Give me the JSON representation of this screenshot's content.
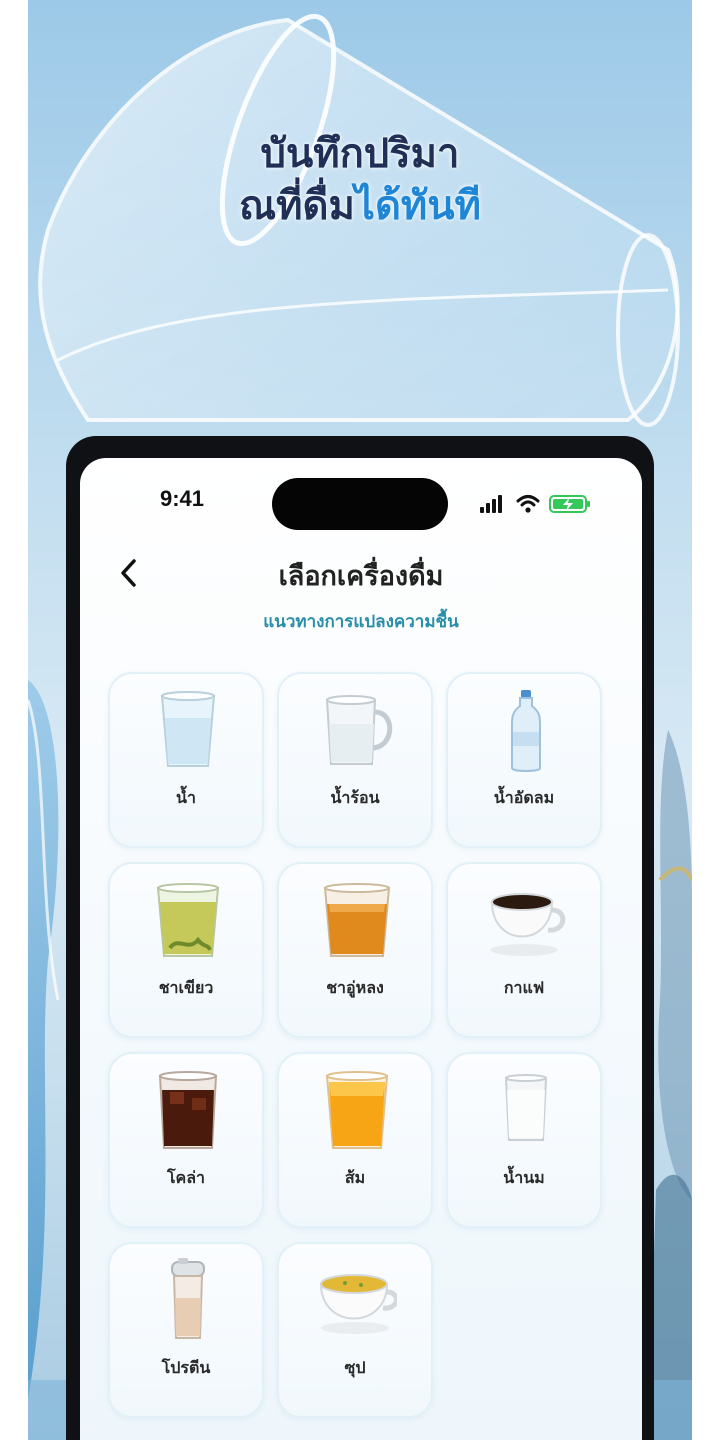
{
  "headline": {
    "line1": "บันทึกปริมา",
    "line2_plain": "ณที่ดื่ม",
    "line2_accent": "ได้ทันที"
  },
  "status_bar": {
    "time": "9:41"
  },
  "header": {
    "title": "เลือกเครื่องดื่ม",
    "subtitle": "แนวทางการแปลงความชื้น"
  },
  "drinks": [
    {
      "label": "น้ำ",
      "icon": "water-glass-icon"
    },
    {
      "label": "น้ำร้อน",
      "icon": "hot-water-mug-icon"
    },
    {
      "label": "น้ำอัดลม",
      "icon": "soda-bottle-icon"
    },
    {
      "label": "ชาเขียว",
      "icon": "green-tea-icon"
    },
    {
      "label": "ชาอู่หลง",
      "icon": "oolong-tea-icon"
    },
    {
      "label": "กาแฟ",
      "icon": "coffee-cup-icon"
    },
    {
      "label": "โคล่า",
      "icon": "cola-glass-icon"
    },
    {
      "label": "ส้ม",
      "icon": "orange-juice-icon"
    },
    {
      "label": "น้ำนม",
      "icon": "milk-glass-icon"
    },
    {
      "label": "โปรตีน",
      "icon": "protein-shaker-icon"
    },
    {
      "label": "ซุป",
      "icon": "soup-bowl-icon"
    }
  ],
  "colors": {
    "accent": "#1f86d6",
    "headline_text": "#1f2f55",
    "subtitle": "#2a8ea8",
    "battery": "#34c759"
  }
}
